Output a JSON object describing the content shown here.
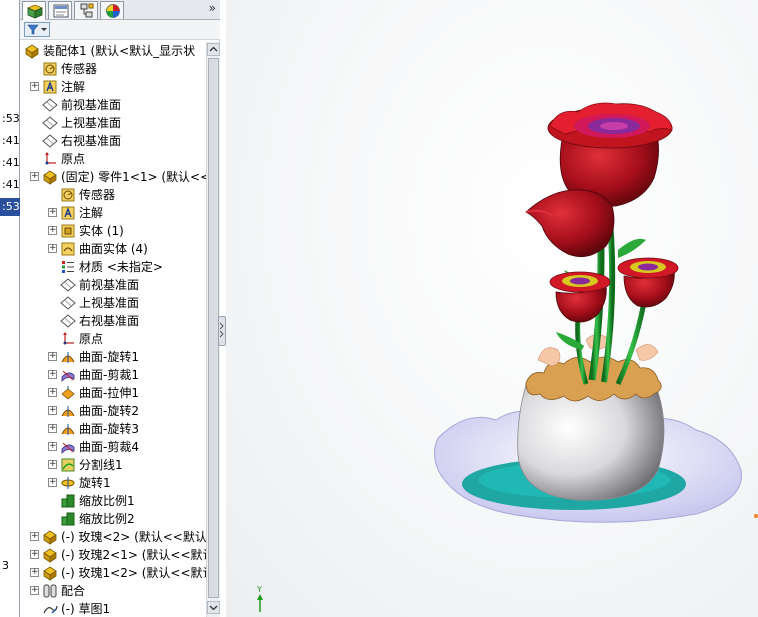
{
  "left_strip": {
    "rows": [
      ":53",
      ":41",
      ":41",
      ":41",
      ":53",
      "3"
    ]
  },
  "panel": {
    "tabs": [
      "featuremanager-tab",
      "propertymanager-tab",
      "configurationmanager-tab",
      "displaymanager-tab"
    ],
    "tabs_more": "»",
    "filter_icon": "filter-icon"
  },
  "tree": {
    "root": "装配体1  (默认<默认_显示状",
    "items": [
      {
        "label": "传感器",
        "icon": "sensor"
      },
      {
        "label": "注解",
        "icon": "annotation"
      },
      {
        "label": "前视基准面",
        "icon": "plane"
      },
      {
        "label": "上视基准面",
        "icon": "plane"
      },
      {
        "label": "右视基准面",
        "icon": "plane"
      },
      {
        "label": "原点",
        "icon": "origin"
      },
      {
        "label": "(固定) 零件1<1> (默认<<",
        "icon": "part"
      },
      {
        "label": "传感器",
        "icon": "sensor"
      },
      {
        "label": "注解",
        "icon": "annotation"
      },
      {
        "label": "实体 (1)",
        "icon": "solid-body"
      },
      {
        "label": "曲面实体 (4)",
        "icon": "surface-body"
      },
      {
        "label": "材质 <未指定>",
        "icon": "material"
      },
      {
        "label": "前视基准面",
        "icon": "plane"
      },
      {
        "label": "上视基准面",
        "icon": "plane"
      },
      {
        "label": "右视基准面",
        "icon": "plane"
      },
      {
        "label": "原点",
        "icon": "origin"
      },
      {
        "label": "曲面-旋转1",
        "icon": "surface-revolve"
      },
      {
        "label": "曲面-剪裁1",
        "icon": "surface-trim"
      },
      {
        "label": "曲面-拉伸1",
        "icon": "surface-extrude"
      },
      {
        "label": "曲面-旋转2",
        "icon": "surface-revolve"
      },
      {
        "label": "曲面-旋转3",
        "icon": "surface-revolve"
      },
      {
        "label": "曲面-剪裁4",
        "icon": "surface-trim"
      },
      {
        "label": "分割线1",
        "icon": "split-line"
      },
      {
        "label": "旋转1",
        "icon": "revolve"
      },
      {
        "label": "缩放比例1",
        "icon": "scale"
      },
      {
        "label": "缩放比例2",
        "icon": "scale"
      },
      {
        "label": "(-) 玫瑰<2> (默认<<默认",
        "icon": "part"
      },
      {
        "label": "(-) 玫瑰2<1> (默认<<默认",
        "icon": "part"
      },
      {
        "label": "(-) 玫瑰1<2> (默认<<默认",
        "icon": "part"
      },
      {
        "label": "配合",
        "icon": "mates"
      },
      {
        "label": "(-) 草图1",
        "icon": "sketch"
      }
    ]
  },
  "viewport": {
    "model": "vase-with-roses",
    "triad_label": "Y",
    "colors": {
      "rose_red": "#b0101c",
      "rose_dark": "#6e0710",
      "stem_green": "#1f9a2e",
      "vase_white": "#e8e8ea",
      "vase_rim": "#c89a4a",
      "plate_teal": "#1fa7a4",
      "petal_purple": "#8a2a9a",
      "petal_yellow": "#d8c820",
      "saucer": "#dcdcf2"
    }
  }
}
